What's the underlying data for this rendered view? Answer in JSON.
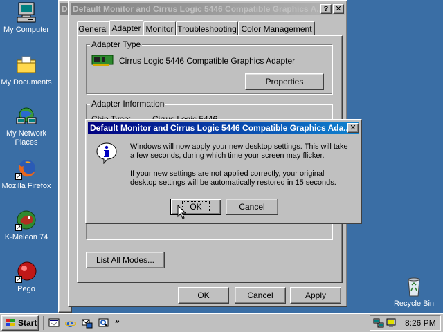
{
  "desktop": {
    "icons": [
      {
        "label": "My Computer",
        "icon": "my-computer-icon"
      },
      {
        "label": "My Documents",
        "icon": "folder-icon"
      },
      {
        "label": "My Network Places",
        "icon": "network-icon"
      },
      {
        "label": "Mozilla Firefox",
        "icon": "firefox-icon"
      },
      {
        "label": "K-Meleon 74",
        "icon": "kmeleon-icon"
      },
      {
        "label": "Pego",
        "icon": "pego-icon"
      },
      {
        "label": "Recycle Bin",
        "icon": "recycle-bin-icon"
      }
    ],
    "background_color": "#3a6ea5"
  },
  "back_window": {
    "title_prefix": "Di"
  },
  "properties_window": {
    "title": "Default Monitor and Cirrus Logic 5446 Compatible Graphics A...",
    "help_btn": "?",
    "close_btn": "✕",
    "tabs": [
      "General",
      "Adapter",
      "Monitor",
      "Troubleshooting",
      "Color Management"
    ],
    "active_tab": "Adapter",
    "adapter_type": {
      "group_label": "Adapter Type",
      "adapter_name": "Cirrus Logic 5446 Compatible Graphics Adapter",
      "properties_btn": "Properties"
    },
    "adapter_info": {
      "group_label": "Adapter Information",
      "chip_type_label": "Chip Type:",
      "chip_type_value": "Cirrus Logic 5446"
    },
    "list_all_modes_btn": "List All Modes...",
    "ok_btn": "OK",
    "cancel_btn": "Cancel",
    "apply_btn": "Apply"
  },
  "dialog": {
    "title": "Default Monitor and Cirrus Logic 5446 Compatible Graphics Ada...",
    "close_btn": "✕",
    "info_icon": "info-icon",
    "message_1": "Windows will now apply your new desktop settings. This will take a few seconds, during which time your screen may flicker.",
    "message_2": "If your new settings are not applied correctly, your original desktop settings will be automatically restored in 15 seconds.",
    "ok_btn": "OK",
    "cancel_btn": "Cancel"
  },
  "taskbar": {
    "start_label": "Start",
    "quick_launch": [
      "show-desktop-icon",
      "internet-explorer-icon",
      "outlook-icon",
      "media-icon"
    ],
    "chevron": "»",
    "clock": "8:26 PM"
  }
}
